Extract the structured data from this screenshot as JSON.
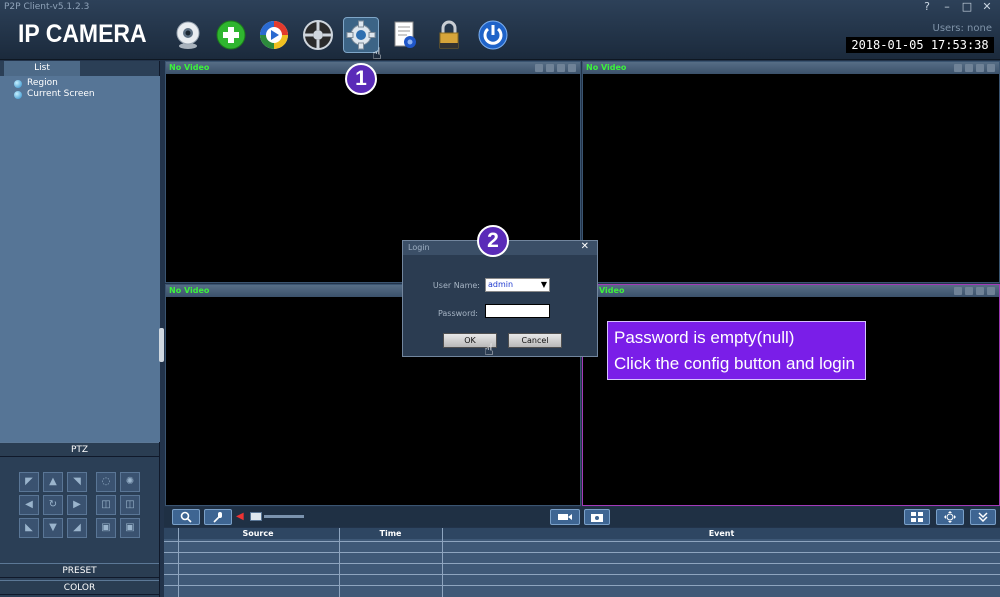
{
  "window": {
    "title": "P2P Client-v5.1.2.3",
    "controls": [
      "?",
      "–",
      "□",
      "✕"
    ]
  },
  "header": {
    "logo": "IP CAMERA",
    "users": "Users: none",
    "clock": "2018-01-05 17:53:38"
  },
  "toolbar": {
    "buttons": [
      {
        "icon": "webcam-icon"
      },
      {
        "icon": "add-icon"
      },
      {
        "icon": "playback-icon"
      },
      {
        "icon": "ptz-control-icon"
      },
      {
        "icon": "config-gear-icon"
      },
      {
        "icon": "record-file-icon"
      },
      {
        "icon": "lock-icon"
      },
      {
        "icon": "power-icon"
      }
    ]
  },
  "sidebar": {
    "tab": "List",
    "tree": [
      "Region",
      "Current Screen"
    ],
    "ptz_header": "PTZ",
    "preset_header": "PRESET",
    "color_header": "COLOR"
  },
  "video": {
    "panes": [
      {
        "label": "No Video"
      },
      {
        "label": "No Video"
      },
      {
        "label": "No Video"
      },
      {
        "label": "Video"
      }
    ]
  },
  "login": {
    "title": "Login",
    "close": "✕",
    "username_label": "User Name:",
    "username_value": "admin",
    "password_label": "Password:",
    "password_value": "",
    "ok_label": "OK",
    "cancel_label": "Cancel"
  },
  "callouts": {
    "step1": "1",
    "step2": "2",
    "note_line1": "Password is empty(null)",
    "note_line2": "Click the config button and login"
  },
  "event_log": {
    "columns": [
      "Source",
      "Time",
      "Event"
    ]
  },
  "colors": {
    "accent": "#7a1ee8",
    "callout": "#5a2bb8",
    "pane_label": "#3cf23c"
  }
}
